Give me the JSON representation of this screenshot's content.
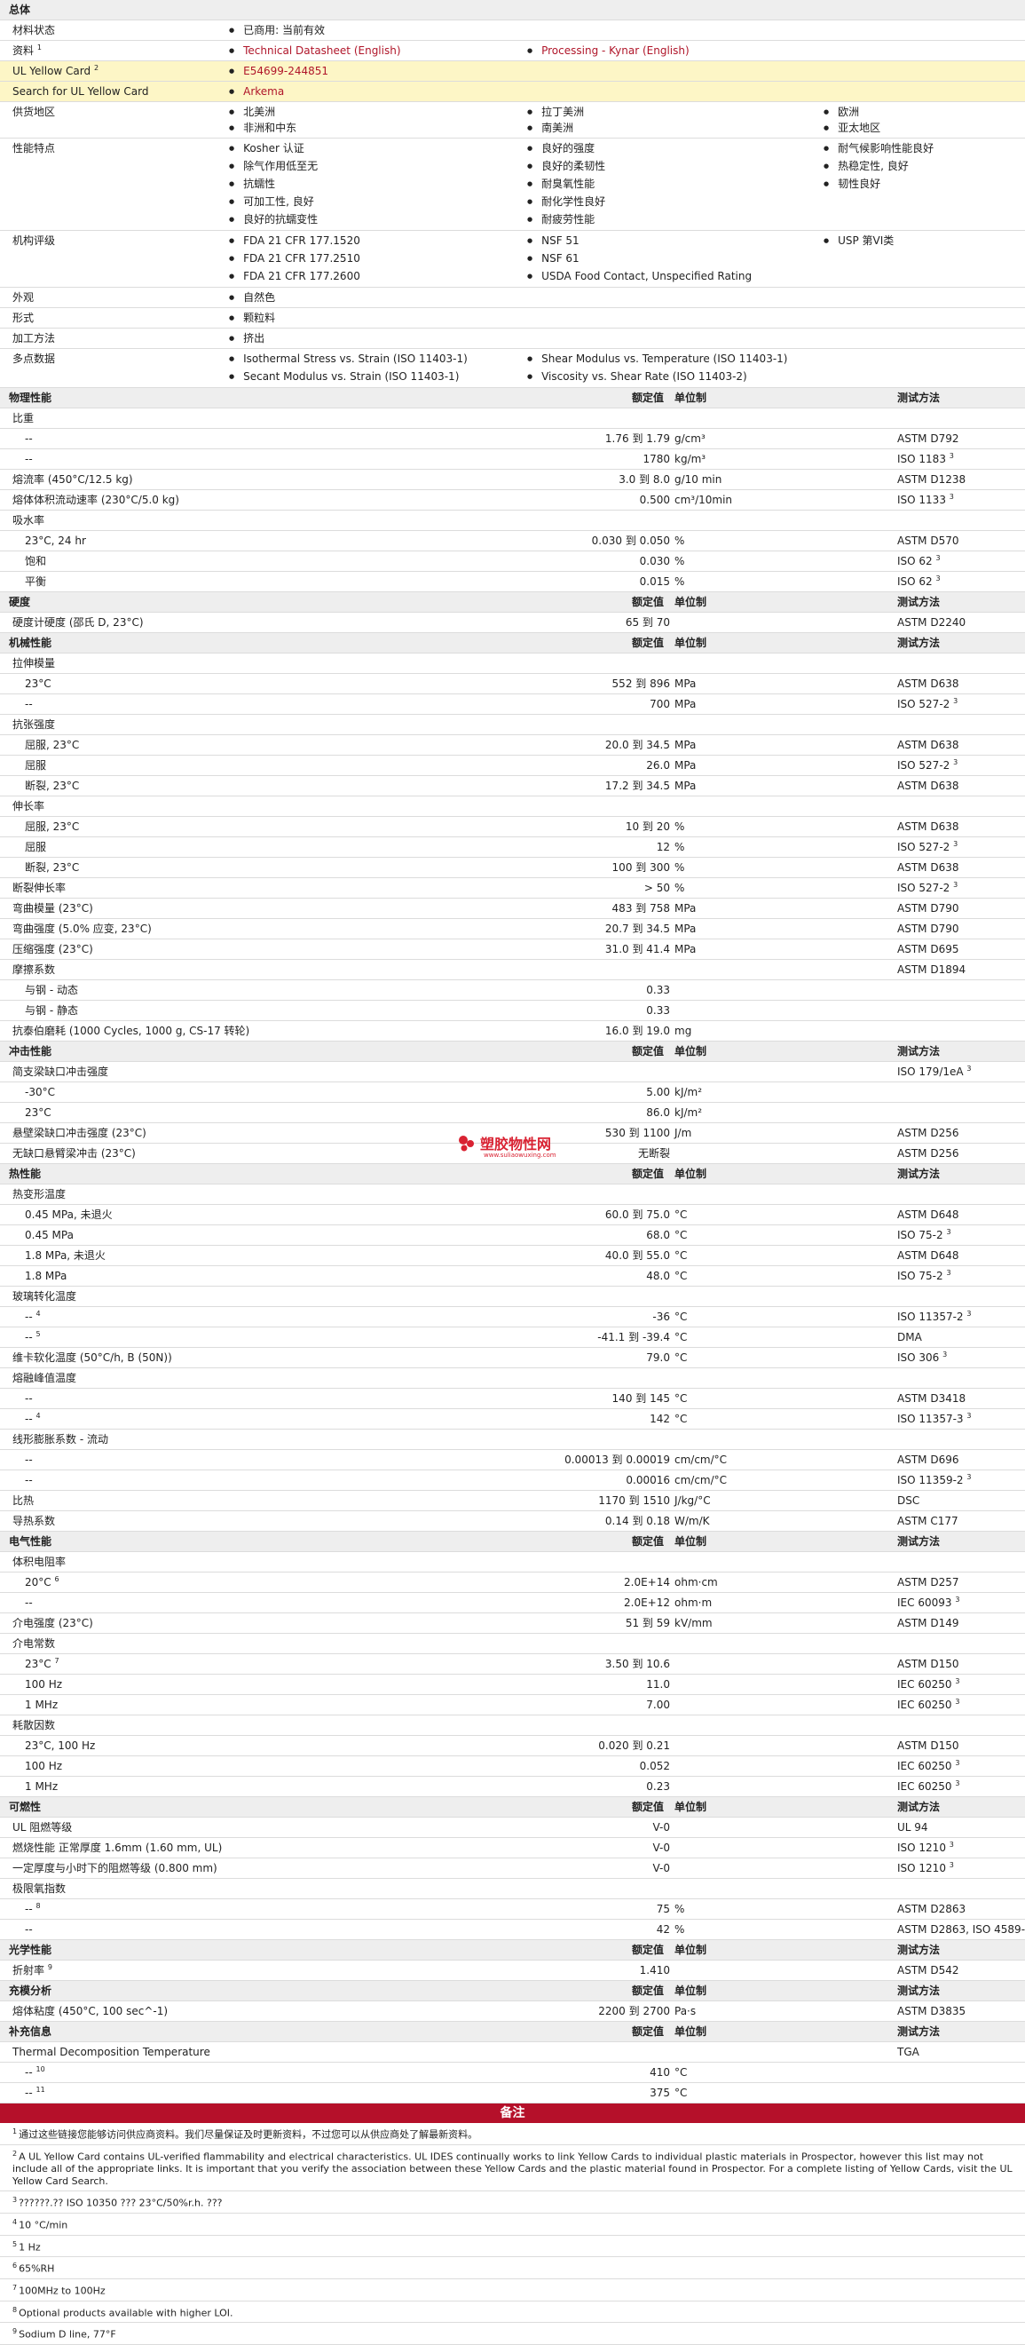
{
  "general": {
    "section": "总体",
    "material_status": {
      "label": "材料状态",
      "value": "已商用: 当前有效"
    },
    "docs": {
      "label": "资料",
      "note": "1",
      "items": [
        "Technical Datasheet (English)",
        "Processing - Kynar (English)"
      ]
    },
    "yellow_card": {
      "label": "UL Yellow Card",
      "note": "2",
      "value": "E54699-244851"
    },
    "search": {
      "label": "Search for UL Yellow Card",
      "value": "Arkema"
    },
    "regions": {
      "label": "供货地区",
      "items": [
        "北美洲",
        "拉丁美洲",
        "欧洲",
        "非洲和中东",
        "南美洲",
        "亚太地区"
      ]
    },
    "features": {
      "label": "性能特点",
      "items": [
        "Kosher 认证",
        "良好的强度",
        "耐气候影响性能良好",
        "除气作用低至无",
        "良好的柔韧性",
        "热稳定性, 良好",
        "抗蠕性",
        "耐臭氧性能",
        "韧性良好",
        "可加工性, 良好",
        "耐化学性良好",
        "良好的抗蠕变性",
        "耐疲劳性能"
      ]
    },
    "agency": {
      "label": "机构评级",
      "items": [
        "FDA 21 CFR 177.1520",
        "NSF 51",
        "USP 第VI类",
        "FDA 21 CFR 177.2510",
        "NSF 61",
        "FDA 21 CFR 177.2600",
        "USDA Food Contact, Unspecified Rating"
      ]
    },
    "appearance": {
      "label": "外观",
      "value": "自然色"
    },
    "form": {
      "label": "形式",
      "value": "颗粒料"
    },
    "processing": {
      "label": "加工方法",
      "value": "挤出"
    },
    "multipoint": {
      "label": "多点数据",
      "items": [
        "Isothermal Stress vs. Strain (ISO 11403-1)",
        "Shear Modulus vs. Temperature (ISO 11403-1)",
        "Secant Modulus vs. Strain (ISO 11403-1)",
        "Viscosity vs. Shear Rate (ISO 11403-2)"
      ]
    }
  },
  "col_headers": {
    "value": "额定值",
    "unit": "单位制",
    "test": "测试方法"
  },
  "rows": [
    {
      "type": "head",
      "label": "物理性能",
      "cols": true
    },
    {
      "type": "group",
      "label": "比重"
    },
    {
      "type": "data",
      "label": "--",
      "sub": true,
      "value": "1.76 到  1.79",
      "unit": "g/cm³",
      "test": "ASTM D792"
    },
    {
      "type": "data",
      "label": "--",
      "sub": true,
      "value": "1780",
      "unit": "kg/m³",
      "test": "ISO 1183",
      "tn": "3"
    },
    {
      "type": "data",
      "label": "熔流率 (450°C/12.5 kg)",
      "value": "3.0 到  8.0",
      "unit": "g/10 min",
      "test": "ASTM D1238"
    },
    {
      "type": "data",
      "label": "熔体体积流动速率 (230°C/5.0 kg)",
      "value": "0.500",
      "unit": "cm³/10min",
      "test": "ISO 1133",
      "tn": "3"
    },
    {
      "type": "group",
      "label": "吸水率"
    },
    {
      "type": "data",
      "label": "23°C, 24 hr",
      "sub": true,
      "value": "0.030 到  0.050",
      "unit": "%",
      "test": "ASTM D570"
    },
    {
      "type": "data",
      "label": "饱和",
      "sub": true,
      "value": "0.030",
      "unit": "%",
      "test": "ISO 62",
      "tn": "3"
    },
    {
      "type": "data",
      "label": "平衡",
      "sub": true,
      "value": "0.015",
      "unit": "%",
      "test": "ISO 62",
      "tn": "3"
    },
    {
      "type": "head",
      "label": "硬度",
      "cols": true
    },
    {
      "type": "data",
      "label": "硬度计硬度 (邵氏 D, 23°C)",
      "value": "65 到  70",
      "unit": "",
      "test": "ASTM D2240"
    },
    {
      "type": "head",
      "label": "机械性能",
      "cols": true
    },
    {
      "type": "group",
      "label": "拉伸模量"
    },
    {
      "type": "data",
      "label": "23°C",
      "sub": true,
      "value": "552 到  896",
      "unit": "MPa",
      "test": "ASTM D638"
    },
    {
      "type": "data",
      "label": "--",
      "sub": true,
      "value": "700",
      "unit": "MPa",
      "test": "ISO 527-2",
      "tn": "3"
    },
    {
      "type": "group",
      "label": "抗张强度"
    },
    {
      "type": "data",
      "label": "屈服, 23°C",
      "sub": true,
      "value": "20.0 到  34.5",
      "unit": "MPa",
      "test": "ASTM D638"
    },
    {
      "type": "data",
      "label": "屈服",
      "sub": true,
      "value": "26.0",
      "unit": "MPa",
      "test": "ISO 527-2",
      "tn": "3"
    },
    {
      "type": "data",
      "label": "断裂, 23°C",
      "sub": true,
      "value": "17.2 到  34.5",
      "unit": "MPa",
      "test": "ASTM D638"
    },
    {
      "type": "group",
      "label": "伸长率"
    },
    {
      "type": "data",
      "label": "屈服, 23°C",
      "sub": true,
      "value": "10 到  20",
      "unit": "%",
      "test": "ASTM D638"
    },
    {
      "type": "data",
      "label": "屈服",
      "sub": true,
      "value": "12",
      "unit": "%",
      "test": "ISO 527-2",
      "tn": "3"
    },
    {
      "type": "data",
      "label": "断裂, 23°C",
      "sub": true,
      "value": "100 到  300",
      "unit": "%",
      "test": "ASTM D638"
    },
    {
      "type": "data",
      "label": "断裂伸长率",
      "value": "> 50",
      "unit": "%",
      "test": "ISO 527-2",
      "tn": "3"
    },
    {
      "type": "data",
      "label": "弯曲模量 (23°C)",
      "value": "483 到  758",
      "unit": "MPa",
      "test": "ASTM D790"
    },
    {
      "type": "data",
      "label": "弯曲强度 (5.0% 应变, 23°C)",
      "value": "20.7 到  34.5",
      "unit": "MPa",
      "test": "ASTM D790"
    },
    {
      "type": "data",
      "label": "压缩强度 (23°C)",
      "value": "31.0 到  41.4",
      "unit": "MPa",
      "test": "ASTM D695"
    },
    {
      "type": "data",
      "label": "摩擦系数",
      "value": "",
      "unit": "",
      "test": "ASTM D1894"
    },
    {
      "type": "data",
      "label": "与钢 - 动态",
      "sub": true,
      "value": "0.33",
      "unit": "",
      "test": ""
    },
    {
      "type": "data",
      "label": "与钢 - 静态",
      "sub": true,
      "value": "0.33",
      "unit": "",
      "test": ""
    },
    {
      "type": "data",
      "label": "抗泰伯磨耗 (1000 Cycles, 1000 g, CS-17 转轮)",
      "value": "16.0 到  19.0",
      "unit": "mg",
      "test": ""
    },
    {
      "type": "head",
      "label": "冲击性能",
      "cols": true
    },
    {
      "type": "data",
      "label": "简支梁缺口冲击强度",
      "value": "",
      "unit": "",
      "test": "ISO 179/1eA",
      "tn": "3"
    },
    {
      "type": "data",
      "label": "-30°C",
      "sub": true,
      "value": "5.00",
      "unit": "kJ/m²",
      "test": ""
    },
    {
      "type": "data",
      "label": "23°C",
      "sub": true,
      "value": "86.0",
      "unit": "kJ/m²",
      "test": ""
    },
    {
      "type": "data",
      "label": "悬壁梁缺口冲击强度 (23°C)",
      "value": "530 到  1100",
      "unit": "J/m",
      "test": "ASTM D256"
    },
    {
      "type": "data",
      "label": "无缺口悬臂梁冲击 (23°C)",
      "value": "无断裂",
      "unit": "",
      "test": "ASTM D256"
    },
    {
      "type": "head",
      "label": "热性能",
      "cols": true
    },
    {
      "type": "group",
      "label": "热变形温度"
    },
    {
      "type": "data",
      "label": "0.45 MPa, 未退火",
      "sub": true,
      "value": "60.0 到  75.0",
      "unit": "°C",
      "test": "ASTM D648"
    },
    {
      "type": "data",
      "label": "0.45 MPa",
      "sub": true,
      "value": "68.0",
      "unit": "°C",
      "test": "ISO 75-2",
      "tn": "3"
    },
    {
      "type": "data",
      "label": "1.8 MPa, 未退火",
      "sub": true,
      "value": "40.0 到  55.0",
      "unit": "°C",
      "test": "ASTM D648"
    },
    {
      "type": "data",
      "label": "1.8 MPa",
      "sub": true,
      "value": "48.0",
      "unit": "°C",
      "test": "ISO 75-2",
      "tn": "3"
    },
    {
      "type": "group",
      "label": "玻璃转化温度"
    },
    {
      "type": "data",
      "label": "--",
      "ln": "4",
      "sub": true,
      "value": "-36",
      "unit": "°C",
      "test": "ISO 11357-2",
      "tn": "3"
    },
    {
      "type": "data",
      "label": "--",
      "ln": "5",
      "sub": true,
      "value": "-41.1 到  -39.4",
      "unit": "°C",
      "test": "DMA"
    },
    {
      "type": "data",
      "label": "维卡软化温度 (50°C/h, B (50N))",
      "value": "79.0",
      "unit": "°C",
      "test": "ISO 306",
      "tn": "3"
    },
    {
      "type": "group",
      "label": "熔融峰值温度"
    },
    {
      "type": "data",
      "label": "--",
      "sub": true,
      "value": "140 到  145",
      "unit": "°C",
      "test": "ASTM D3418"
    },
    {
      "type": "data",
      "label": "--",
      "ln": "4",
      "sub": true,
      "value": "142",
      "unit": "°C",
      "test": "ISO 11357-3",
      "tn": "3"
    },
    {
      "type": "group",
      "label": "线形膨胀系数 - 流动"
    },
    {
      "type": "data",
      "label": "--",
      "sub": true,
      "value": "0.00013 到  0.00019",
      "unit": "cm/cm/°C",
      "test": "ASTM D696"
    },
    {
      "type": "data",
      "label": "--",
      "sub": true,
      "value": "0.00016",
      "unit": "cm/cm/°C",
      "test": "ISO 11359-2",
      "tn": "3"
    },
    {
      "type": "data",
      "label": "比热",
      "value": "1170 到  1510",
      "unit": "J/kg/°C",
      "test": "DSC"
    },
    {
      "type": "data",
      "label": "导热系数",
      "value": "0.14 到  0.18",
      "unit": "W/m/K",
      "test": "ASTM C177"
    },
    {
      "type": "head",
      "label": "电气性能",
      "cols": true
    },
    {
      "type": "group",
      "label": "体积电阻率"
    },
    {
      "type": "data",
      "label": "20°C",
      "ln": "6",
      "sub": true,
      "value": "2.0E+14",
      "unit": "ohm·cm",
      "test": "ASTM D257"
    },
    {
      "type": "data",
      "label": "--",
      "sub": true,
      "value": "2.0E+12",
      "unit": "ohm·m",
      "test": "IEC 60093",
      "tn": "3"
    },
    {
      "type": "data",
      "label": "介电强度 (23°C)",
      "value": "51 到  59",
      "unit": "kV/mm",
      "test": "ASTM D149"
    },
    {
      "type": "group",
      "label": "介电常数"
    },
    {
      "type": "data",
      "label": "23°C",
      "ln": "7",
      "sub": true,
      "value": "3.50 到  10.6",
      "unit": "",
      "test": "ASTM D150"
    },
    {
      "type": "data",
      "label": "100 Hz",
      "sub": true,
      "value": "11.0",
      "unit": "",
      "test": "IEC 60250",
      "tn": "3"
    },
    {
      "type": "data",
      "label": "1 MHz",
      "sub": true,
      "value": "7.00",
      "unit": "",
      "test": "IEC 60250",
      "tn": "3"
    },
    {
      "type": "group",
      "label": "耗散因数"
    },
    {
      "type": "data",
      "label": "23°C, 100 Hz",
      "sub": true,
      "value": "0.020 到  0.21",
      "unit": "",
      "test": "ASTM D150"
    },
    {
      "type": "data",
      "label": "100 Hz",
      "sub": true,
      "value": "0.052",
      "unit": "",
      "test": "IEC 60250",
      "tn": "3"
    },
    {
      "type": "data",
      "label": "1 MHz",
      "sub": true,
      "value": "0.23",
      "unit": "",
      "test": "IEC 60250",
      "tn": "3"
    },
    {
      "type": "head",
      "label": "可燃性",
      "cols": true
    },
    {
      "type": "data",
      "label": "UL 阻燃等级",
      "value": "V-0",
      "unit": "",
      "test": "UL 94"
    },
    {
      "type": "data",
      "label": "燃烧性能  正常厚度  1.6mm (1.60 mm, UL)",
      "value": "V-0",
      "unit": "",
      "test": "ISO 1210",
      "tn": "3"
    },
    {
      "type": "data",
      "label": "一定厚度与小时下的阻燃等级 (0.800 mm)",
      "value": "V-0",
      "unit": "",
      "test": "ISO 1210",
      "tn": "3"
    },
    {
      "type": "group",
      "label": "极限氧指数"
    },
    {
      "type": "data",
      "label": "--",
      "ln": "8",
      "sub": true,
      "value": "75",
      "unit": "%",
      "test": "ASTM D2863"
    },
    {
      "type": "data",
      "label": "--",
      "sub": true,
      "value": "42",
      "unit": "%",
      "test": "ASTM D2863, ISO 4589-2"
    },
    {
      "type": "head",
      "label": "光学性能",
      "cols": true
    },
    {
      "type": "data",
      "label": "折射率",
      "ln": "9",
      "value": "1.410",
      "unit": "",
      "test": "ASTM D542"
    },
    {
      "type": "head",
      "label": "充模分析",
      "cols": true
    },
    {
      "type": "data",
      "label": "熔体粘度 (450°C, 100 sec^-1)",
      "value": "2200 到  2700",
      "unit": "Pa·s",
      "test": "ASTM D3835"
    },
    {
      "type": "head",
      "label": "补充信息",
      "cols": true
    },
    {
      "type": "data",
      "label": "Thermal Decomposition Temperature",
      "value": "",
      "unit": "",
      "test": "TGA"
    },
    {
      "type": "data",
      "label": "--",
      "ln": "10",
      "sub": true,
      "value": "410",
      "unit": "°C",
      "test": ""
    },
    {
      "type": "data",
      "label": "--",
      "ln": "11",
      "sub": true,
      "value": "375",
      "unit": "°C",
      "test": ""
    }
  ],
  "notes": {
    "title": "备注",
    "items": [
      {
        "n": "1",
        "text": "通过这些链接您能够访问供应商资料。我们尽量保证及时更新资料，不过您可以从供应商处了解最新资料。"
      },
      {
        "n": "2",
        "text": "A UL Yellow Card contains UL-verified flammability and electrical characteristics. UL IDES continually works to link Yellow Cards to individual plastic materials in Prospector, however this list may not include all of the appropriate links. It is important that you verify the association between these Yellow Cards and the plastic material found in Prospector. For a complete listing of Yellow Cards, visit the UL Yellow Card Search."
      },
      {
        "n": "3",
        "text": "??????.?? ISO 10350 ??? 23°C/50%r.h. ???"
      },
      {
        "n": "4",
        "text": "10 °C/min"
      },
      {
        "n": "5",
        "text": "1 Hz"
      },
      {
        "n": "6",
        "text": "65%RH"
      },
      {
        "n": "7",
        "text": "100MHz to 100Hz"
      },
      {
        "n": "8",
        "text": "Optional products available with higher LOI."
      },
      {
        "n": "9",
        "text": "Sodium D line, 77°F"
      }
    ]
  },
  "watermark": {
    "text": "塑胶物性网",
    "sub": "www.suliaowuxing.com"
  },
  "colors": {
    "link": "#b0162a",
    "header_bg": "#eeeeee",
    "highlight_bg": "#fdf6c6",
    "notes_bar": "#b5102a"
  }
}
